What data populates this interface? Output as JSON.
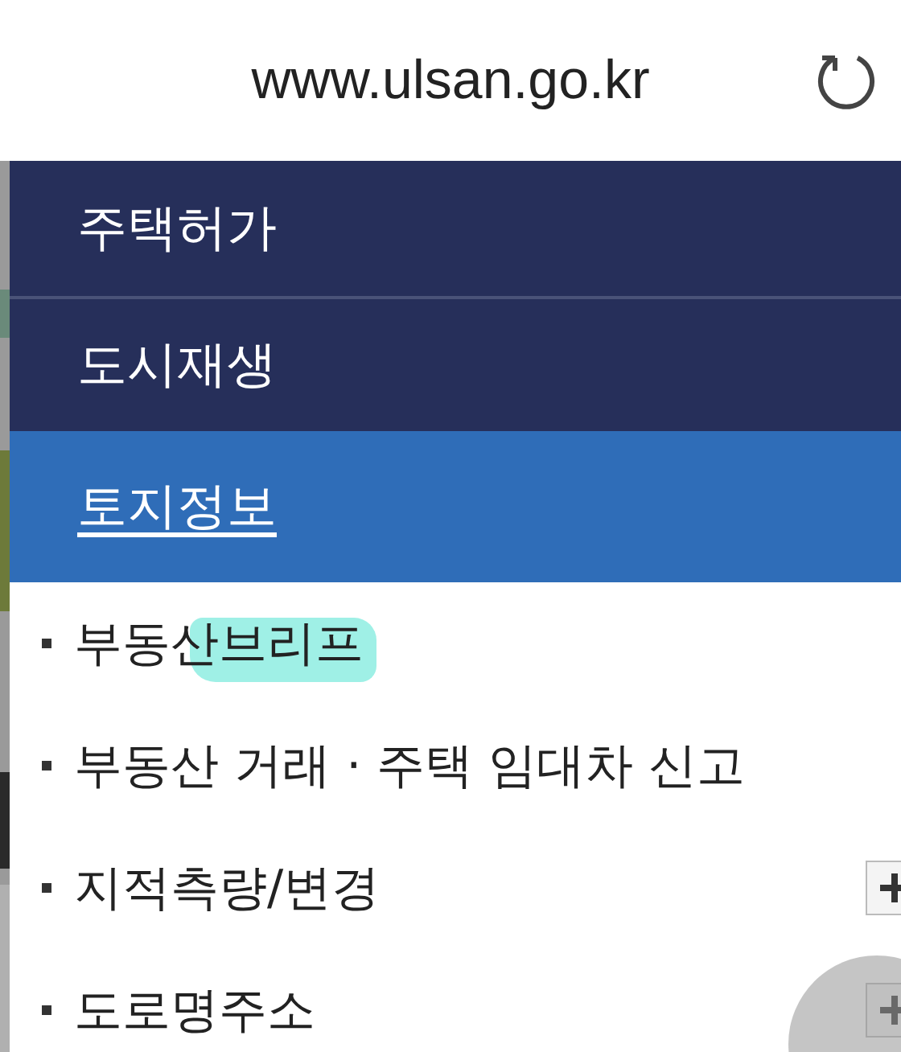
{
  "address_bar": {
    "url": "www.ulsan.go.kr"
  },
  "menu": [
    {
      "label": "주택허가",
      "selected": false
    },
    {
      "label": "도시재생",
      "selected": false
    },
    {
      "label": "토지정보",
      "selected": true
    }
  ],
  "submenu": [
    {
      "label": "부동산브리프",
      "kind": "link",
      "highlighted": true
    },
    {
      "label": "부동산 거래 · 주택 임대차 신고",
      "kind": "link",
      "highlighted": false
    },
    {
      "label": "지적측량/변경",
      "kind": "toggle",
      "highlighted": false
    },
    {
      "label": "도로명주소",
      "kind": "toggle",
      "highlighted": false
    }
  ]
}
